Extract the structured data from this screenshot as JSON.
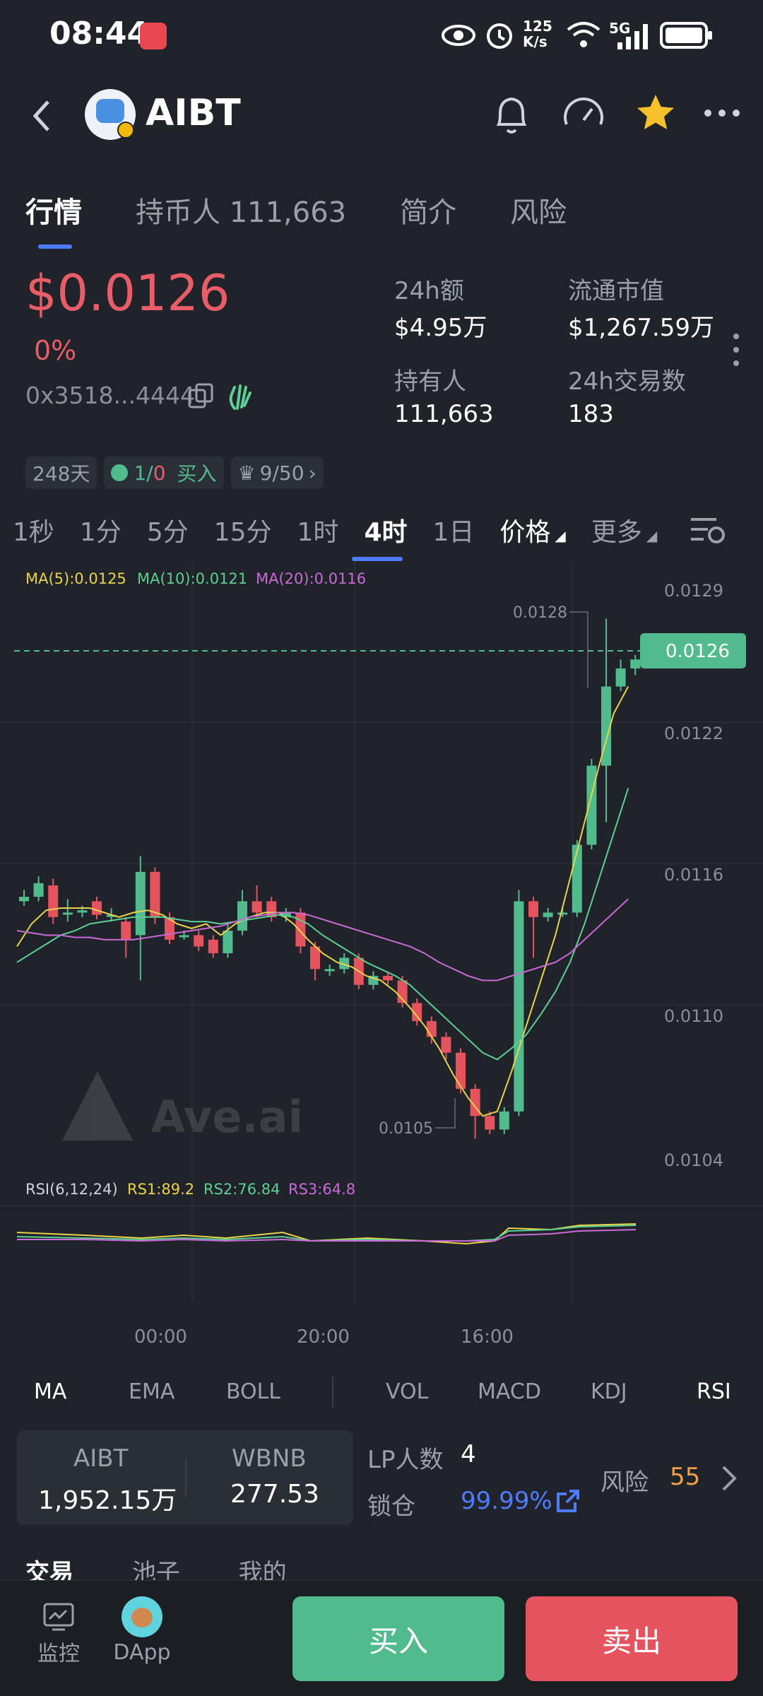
{
  "status": {
    "time": "08:44",
    "net_speed": "125\nK/s",
    "network": "5G"
  },
  "header": {
    "title": "AIBT"
  },
  "tabs": [
    {
      "label": "行情",
      "active": true
    },
    {
      "label": "持币人 111,663",
      "active": false
    },
    {
      "label": "简介",
      "active": false
    },
    {
      "label": "风险",
      "active": false
    }
  ],
  "price": {
    "value": "$0.0126",
    "change": "0%",
    "address": "0x3518...4444"
  },
  "stats": {
    "vol24_label": "24h额",
    "vol24_value": "$4.95万",
    "mcap_label": "流通市值",
    "mcap_value": "$1,267.59万",
    "holders_label": "持有人",
    "holders_value": "111,663",
    "tx_label": "24h交易数",
    "tx_value": "183"
  },
  "chips": {
    "age": "248天",
    "buysell_prefix": "1/",
    "buysell_red": "0",
    "buysell_text": "买入",
    "rank": "9/50"
  },
  "timeframes": [
    "1秒",
    "1分",
    "5分",
    "15分",
    "1时",
    "4时",
    "1日"
  ],
  "timeframe_active": "4时",
  "dropdowns": {
    "price": "价格",
    "more": "更多"
  },
  "ma_legend": {
    "ma5": "MA(5):0.0125",
    "ma10": "MA(10):0.0121",
    "ma20": "MA(20):0.0116"
  },
  "chart_data": {
    "type": "candlestick",
    "y_axis_ticks": [
      "0.0129",
      "0.0122",
      "0.0116",
      "0.0110",
      "0.0104"
    ],
    "current_price": "0.0126",
    "high_label": "0.0128",
    "low_label": "0.0105",
    "x_axis_ticks": [
      "00:00",
      "20:00",
      "16:00"
    ],
    "watermark": "Ave.ai",
    "candles": [
      {
        "o": 0.01155,
        "c": 0.01157,
        "h": 0.0116,
        "l": 0.01153
      },
      {
        "o": 0.01157,
        "c": 0.01163,
        "h": 0.01166,
        "l": 0.01155
      },
      {
        "o": 0.01162,
        "c": 0.01148,
        "h": 0.01165,
        "l": 0.01145
      },
      {
        "o": 0.0115,
        "c": 0.0115,
        "h": 0.01156,
        "l": 0.01146
      },
      {
        "o": 0.0115,
        "c": 0.01151,
        "h": 0.01153,
        "l": 0.01148
      },
      {
        "o": 0.01155,
        "c": 0.01149,
        "h": 0.01157,
        "l": 0.01147
      },
      {
        "o": 0.01149,
        "c": 0.01149,
        "h": 0.01152,
        "l": 0.01146
      },
      {
        "o": 0.01146,
        "c": 0.01138,
        "h": 0.01148,
        "l": 0.0113
      },
      {
        "o": 0.0114,
        "c": 0.01168,
        "h": 0.01175,
        "l": 0.0112
      },
      {
        "o": 0.01168,
        "c": 0.01148,
        "h": 0.0117,
        "l": 0.01145
      },
      {
        "o": 0.01148,
        "c": 0.01138,
        "h": 0.0115,
        "l": 0.01136
      },
      {
        "o": 0.0114,
        "c": 0.0114,
        "h": 0.01142,
        "l": 0.01138
      },
      {
        "o": 0.0114,
        "c": 0.01135,
        "h": 0.01142,
        "l": 0.01133
      },
      {
        "o": 0.01138,
        "c": 0.01132,
        "h": 0.0114,
        "l": 0.0113
      },
      {
        "o": 0.01132,
        "c": 0.01142,
        "h": 0.01145,
        "l": 0.0113
      },
      {
        "o": 0.01142,
        "c": 0.01155,
        "h": 0.0116,
        "l": 0.0114
      },
      {
        "o": 0.01155,
        "c": 0.0115,
        "h": 0.01162,
        "l": 0.01148
      },
      {
        "o": 0.01155,
        "c": 0.01148,
        "h": 0.01157,
        "l": 0.01146
      },
      {
        "o": 0.01148,
        "c": 0.0115,
        "h": 0.01152,
        "l": 0.01146
      },
      {
        "o": 0.0115,
        "c": 0.01135,
        "h": 0.01152,
        "l": 0.01132
      },
      {
        "o": 0.01135,
        "c": 0.01125,
        "h": 0.01137,
        "l": 0.0112
      },
      {
        "o": 0.01125,
        "c": 0.01125,
        "h": 0.01127,
        "l": 0.01122
      },
      {
        "o": 0.01125,
        "c": 0.0113,
        "h": 0.01132,
        "l": 0.01123
      },
      {
        "o": 0.0113,
        "c": 0.01118,
        "h": 0.01132,
        "l": 0.01116
      },
      {
        "o": 0.01118,
        "c": 0.01122,
        "h": 0.01124,
        "l": 0.01116
      },
      {
        "o": 0.01122,
        "c": 0.0112,
        "h": 0.01124,
        "l": 0.01118
      },
      {
        "o": 0.0112,
        "c": 0.0111,
        "h": 0.01122,
        "l": 0.01108
      },
      {
        "o": 0.0111,
        "c": 0.01102,
        "h": 0.01112,
        "l": 0.011
      },
      {
        "o": 0.01102,
        "c": 0.01095,
        "h": 0.01104,
        "l": 0.01092
      },
      {
        "o": 0.01095,
        "c": 0.01088,
        "h": 0.01097,
        "l": 0.01085
      },
      {
        "o": 0.01088,
        "c": 0.01072,
        "h": 0.0109,
        "l": 0.0107
      },
      {
        "o": 0.01072,
        "c": 0.0106,
        "h": 0.01074,
        "l": 0.0105
      },
      {
        "o": 0.0106,
        "c": 0.01054,
        "h": 0.01062,
        "l": 0.01052
      },
      {
        "o": 0.01054,
        "c": 0.01062,
        "h": 0.01064,
        "l": 0.01052
      },
      {
        "o": 0.01062,
        "c": 0.01155,
        "h": 0.0116,
        "l": 0.0106
      },
      {
        "o": 0.01155,
        "c": 0.01148,
        "h": 0.01157,
        "l": 0.0113
      },
      {
        "o": 0.01148,
        "c": 0.0115,
        "h": 0.01152,
        "l": 0.01146
      },
      {
        "o": 0.0115,
        "c": 0.0115,
        "h": 0.01153,
        "l": 0.01148
      },
      {
        "o": 0.0115,
        "c": 0.0118,
        "h": 0.01182,
        "l": 0.01148
      },
      {
        "o": 0.0118,
        "c": 0.01215,
        "h": 0.01218,
        "l": 0.01178
      },
      {
        "o": 0.01215,
        "c": 0.0125,
        "h": 0.0128,
        "l": 0.0119
      },
      {
        "o": 0.0125,
        "c": 0.01258,
        "h": 0.01262,
        "l": 0.01248
      },
      {
        "o": 0.01258,
        "c": 0.01262,
        "h": 0.01264,
        "l": 0.01255
      },
      {
        "o": 0.01262,
        "c": 0.01264,
        "h": 0.01266,
        "l": 0.0126
      }
    ],
    "ma5": [
      0.01135,
      0.01145,
      0.01151,
      0.01152,
      0.01152,
      0.01152,
      0.0115,
      0.01148,
      0.0115,
      0.01151,
      0.01149,
      0.01145,
      0.01143,
      0.01145,
      0.0114,
      0.01145,
      0.01148,
      0.0115,
      0.0115,
      0.01145,
      0.01138,
      0.01132,
      0.01128,
      0.01126,
      0.01122,
      0.0112,
      0.01115,
      0.01108,
      0.011,
      0.0109,
      0.01078,
      0.01068,
      0.0106,
      0.01062,
      0.0108,
      0.011,
      0.0112,
      0.0114,
      0.01165,
      0.0119,
      0.01215,
      0.01238,
      0.0125
    ],
    "ma10": [
      0.01128,
      0.01132,
      0.01136,
      0.0114,
      0.01142,
      0.01145,
      0.01146,
      0.01147,
      0.01148,
      0.01148,
      0.01148,
      0.01147,
      0.01146,
      0.01146,
      0.01145,
      0.01146,
      0.01147,
      0.01148,
      0.01149,
      0.01148,
      0.01145,
      0.0114,
      0.01136,
      0.01132,
      0.01128,
      0.01125,
      0.01122,
      0.01118,
      0.01112,
      0.01106,
      0.011,
      0.01094,
      0.01088,
      0.01085,
      0.0109,
      0.01096,
      0.01105,
      0.01115,
      0.01128,
      0.01145,
      0.01165,
      0.01185,
      0.01205
    ],
    "ma20": [
      0.01142,
      0.01141,
      0.0114,
      0.0114,
      0.01139,
      0.01139,
      0.01138,
      0.01138,
      0.01138,
      0.01139,
      0.0114,
      0.01141,
      0.01142,
      0.01143,
      0.01144,
      0.01146,
      0.01148,
      0.01149,
      0.0115,
      0.0115,
      0.01149,
      0.01147,
      0.01145,
      0.01143,
      0.01141,
      0.01139,
      0.01137,
      0.01135,
      0.01132,
      0.01128,
      0.01125,
      0.01122,
      0.0112,
      0.0112,
      0.01122,
      0.01124,
      0.01126,
      0.01128,
      0.01132,
      0.01138,
      0.01144,
      0.0115,
      0.01156
    ]
  },
  "rsi_legend": {
    "label": "RSI(6,12,24)",
    "rs1": "RS1:89.2",
    "rs2": "RS2:76.84",
    "rs3": "RS3:64.8"
  },
  "indicators": [
    "MA",
    "EMA",
    "BOLL",
    "VOL",
    "MACD",
    "KDJ",
    "RSI"
  ],
  "indicators_active": [
    "MA",
    "RSI"
  ],
  "pool": {
    "token_a": "AIBT",
    "amount_a": "1,952.15万",
    "token_b": "WBNB",
    "amount_b": "277.53"
  },
  "lp": {
    "holders_label": "LP人数",
    "holders_value": "4",
    "lock_label": "锁仓",
    "lock_value": "99.99%"
  },
  "risk": {
    "label": "风险",
    "value": "55"
  },
  "sub_tabs": [
    "交易",
    "池子",
    "我的"
  ],
  "bottom_nav": {
    "monitor": "监控",
    "dapp": "DApp",
    "buy": "买入",
    "sell": "卖出"
  }
}
